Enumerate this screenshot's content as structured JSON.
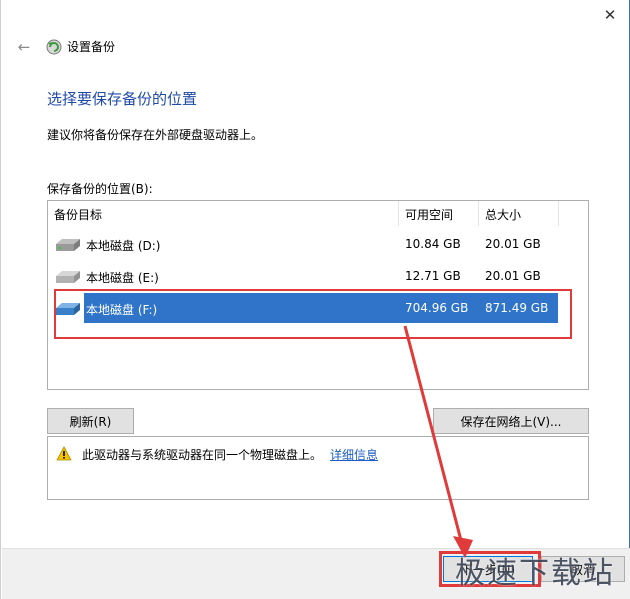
{
  "window": {
    "title": "设置备份",
    "close_glyph": "✕",
    "back_glyph": "←"
  },
  "page": {
    "heading": "选择要保存备份的位置",
    "advice": "建议你将备份保存在外部硬盘驱动器上。",
    "list_label": "保存备份的位置(B):"
  },
  "table": {
    "columns": [
      "备份目标",
      "可用空间",
      "总大小"
    ],
    "rows": [
      {
        "name": "本地磁盘 (D:)",
        "free": "10.84 GB",
        "total": "20.01 GB",
        "icon": "hard-drive-icon"
      },
      {
        "name": "本地磁盘 (E:)",
        "free": "12.71 GB",
        "total": "20.01 GB",
        "icon": "hard-drive-icon"
      },
      {
        "name": "本地磁盘 (F:)",
        "free": "704.96 GB",
        "total": "871.49 GB",
        "icon": "hard-drive-icon",
        "selected": true
      }
    ]
  },
  "buttons": {
    "refresh": "刷新(R)",
    "save_network": "保存在网络上(V)...",
    "next": "下一步(N)",
    "cancel": "取消"
  },
  "warning": {
    "text": "此驱动器与系统驱动器在同一个物理磁盘上。",
    "link": "详细信息"
  },
  "watermark": "极速下载站",
  "colors": {
    "accent": "#2f74c9",
    "heading": "#1f4aa8",
    "annotation_red": "#e03a3a",
    "link": "#1c5cc4"
  }
}
